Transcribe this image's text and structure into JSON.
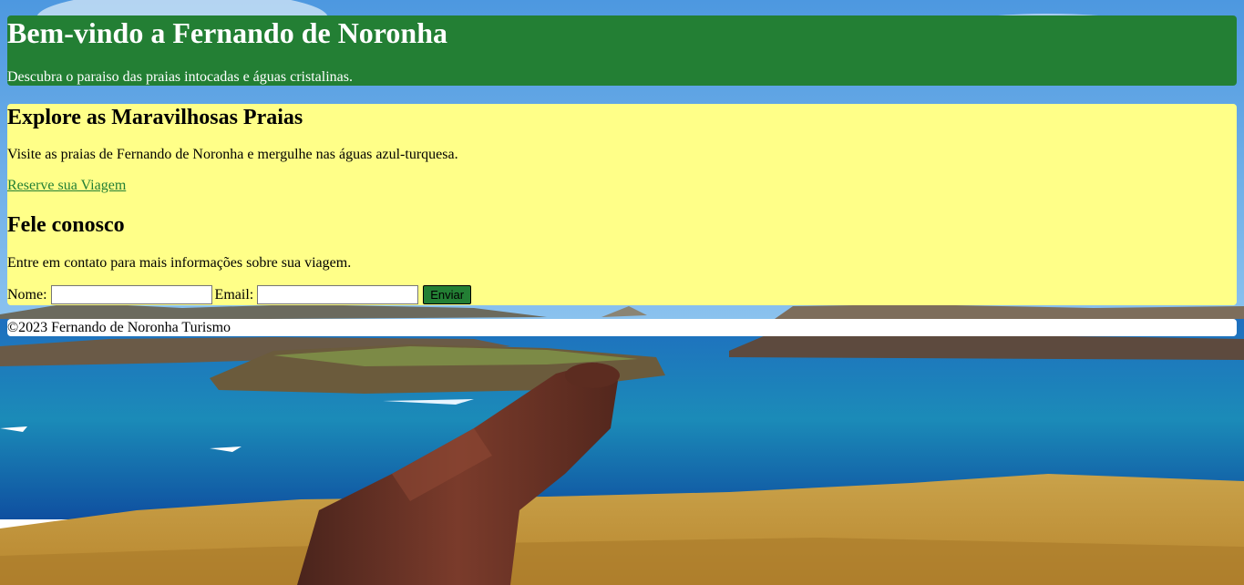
{
  "header": {
    "title": "Bem-vindo a Fernando de Noronha",
    "subtitle": "Descubra o paraiso das praias intocadas e águas cristalinas."
  },
  "explore": {
    "heading": "Explore as Maravilhosas Praias",
    "text": "Visite as praias de Fernando de Noronha e mergulhe nas águas azul-turquesa.",
    "link": "Reserve sua Viagem"
  },
  "contact": {
    "heading": "Fele conosco",
    "text": "Entre em contato para mais informações sobre sua viagem.",
    "name_label": "Nome:",
    "name_value": "",
    "email_label": "Email:",
    "email_value": "",
    "submit_label": "Enviar"
  },
  "footer": {
    "text": "©2023 Fernando de Noronha Turismo"
  },
  "colors": {
    "header_bg": "#237f34",
    "main_bg": "#ffff88",
    "link": "#237f34"
  },
  "icons": {
    "background": "beach-cannon-photo"
  }
}
